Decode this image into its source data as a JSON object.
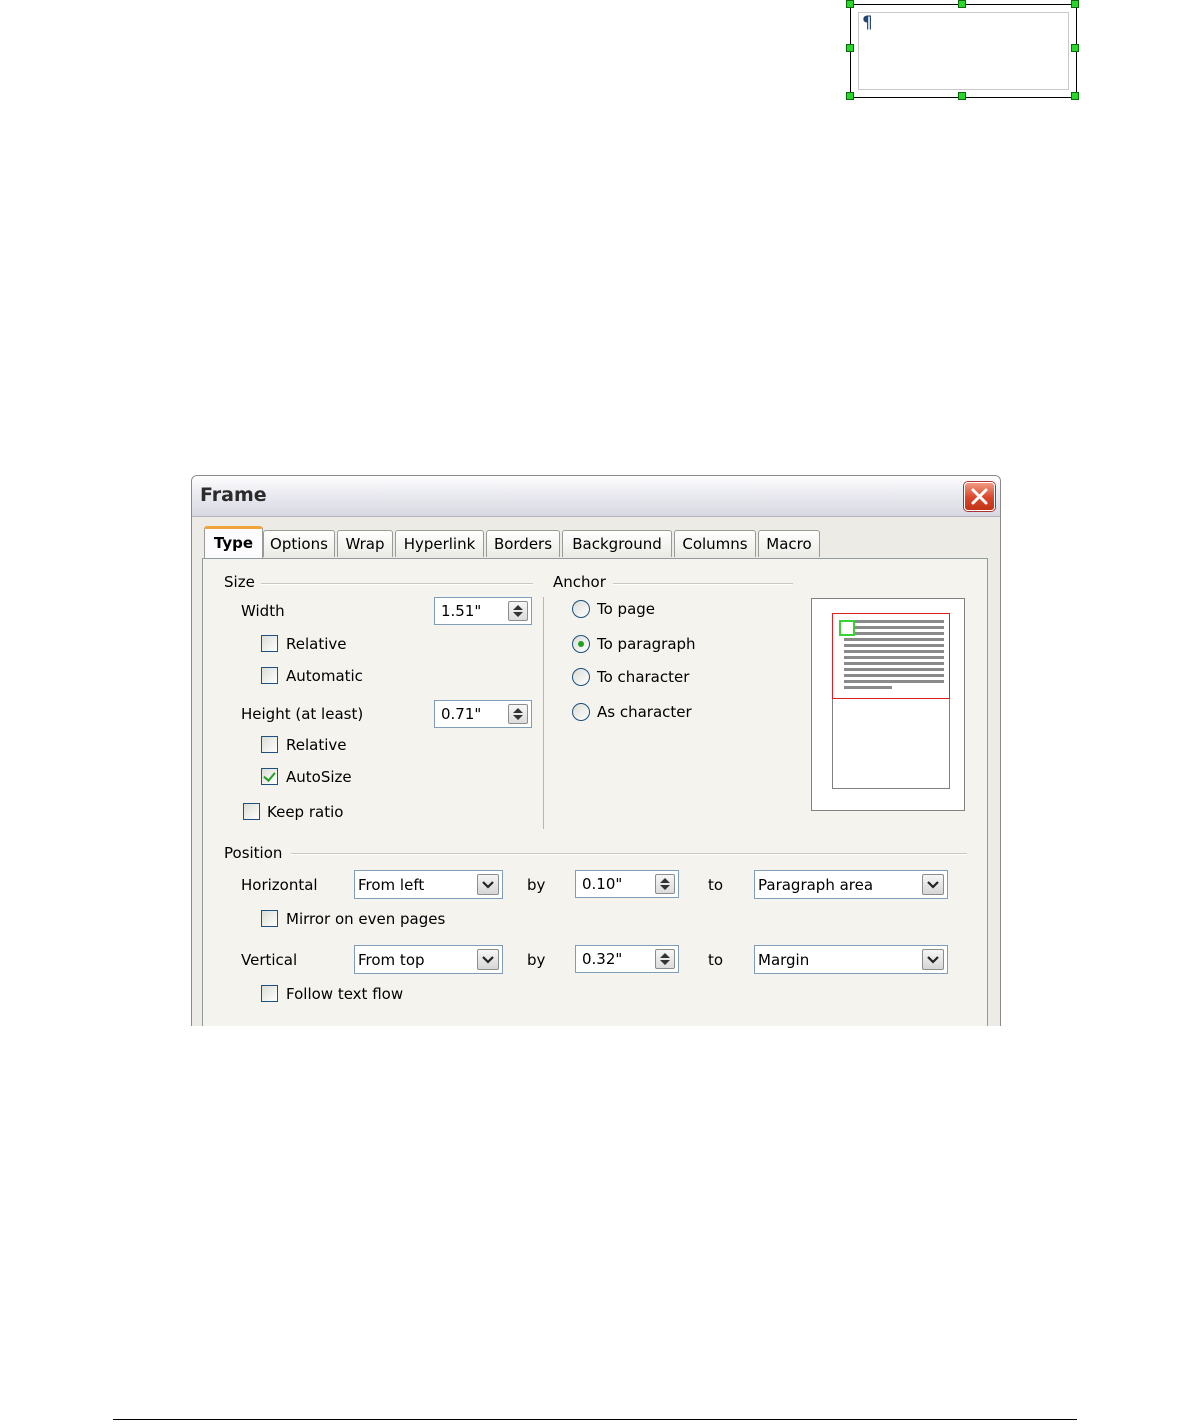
{
  "page": {
    "paragraph_mark": "¶"
  },
  "dialog": {
    "title": "Frame",
    "tabs": [
      "Type",
      "Options",
      "Wrap",
      "Hyperlink",
      "Borders",
      "Background",
      "Columns",
      "Macro"
    ],
    "active_tab": "Type",
    "size": {
      "heading": "Size",
      "width_label": "Width",
      "width_value": "1.51\"",
      "width_relative_label": "Relative",
      "width_relative_checked": false,
      "automatic_label": "Automatic",
      "automatic_checked": false,
      "height_label": "Height (at least)",
      "height_value": "0.71\"",
      "height_relative_label": "Relative",
      "height_relative_checked": false,
      "autosize_label": "AutoSize",
      "autosize_checked": true,
      "keep_ratio_label": "Keep ratio",
      "keep_ratio_checked": false
    },
    "anchor": {
      "heading": "Anchor",
      "options": [
        "To page",
        "To paragraph",
        "To character",
        "As character"
      ],
      "selected": "To paragraph"
    },
    "position": {
      "heading": "Position",
      "horizontal_label": "Horizontal",
      "horizontal_value": "From left",
      "horizontal_by_label": "by",
      "horizontal_by_value": "0.10\"",
      "horizontal_to_label": "to",
      "horizontal_to_value": "Paragraph area",
      "mirror_label": "Mirror on even pages",
      "mirror_checked": false,
      "vertical_label": "Vertical",
      "vertical_value": "From top",
      "vertical_by_label": "by",
      "vertical_by_value": "0.32\"",
      "vertical_to_label": "to",
      "vertical_to_value": "Margin",
      "follow_label": "Follow text flow",
      "follow_checked": false
    },
    "colors": {
      "tab_accent": "#f2a43a",
      "check": "#21a121",
      "preview_paragraph": "#e02020",
      "preview_frame": "#35d335"
    }
  }
}
